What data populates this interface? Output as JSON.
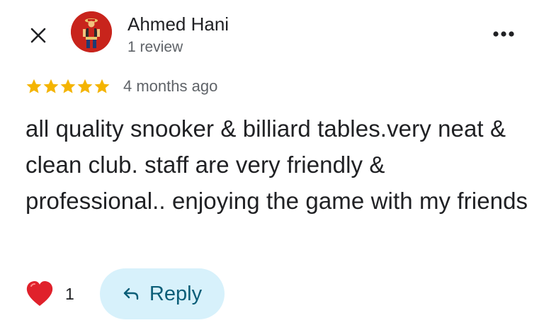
{
  "header": {
    "author_name": "Ahmed Hani",
    "review_count": "1 review",
    "close_icon": "close-icon",
    "more_icon": "more-horizontal-icon"
  },
  "rating": {
    "stars": 5,
    "max_stars": 5,
    "date": "4 months ago",
    "star_color": "#f4b400"
  },
  "review": {
    "text": "all quality snooker & billiard tables.very neat & clean club. staff are very friendly & professional.. enjoying the game with my friends"
  },
  "actions": {
    "reaction_icon": "heart-icon",
    "reaction_count": "1",
    "reply_label": "Reply",
    "reply_icon": "reply-arrow-icon",
    "reply_bg": "#d7f1fb",
    "reply_color": "#0b5e78"
  }
}
